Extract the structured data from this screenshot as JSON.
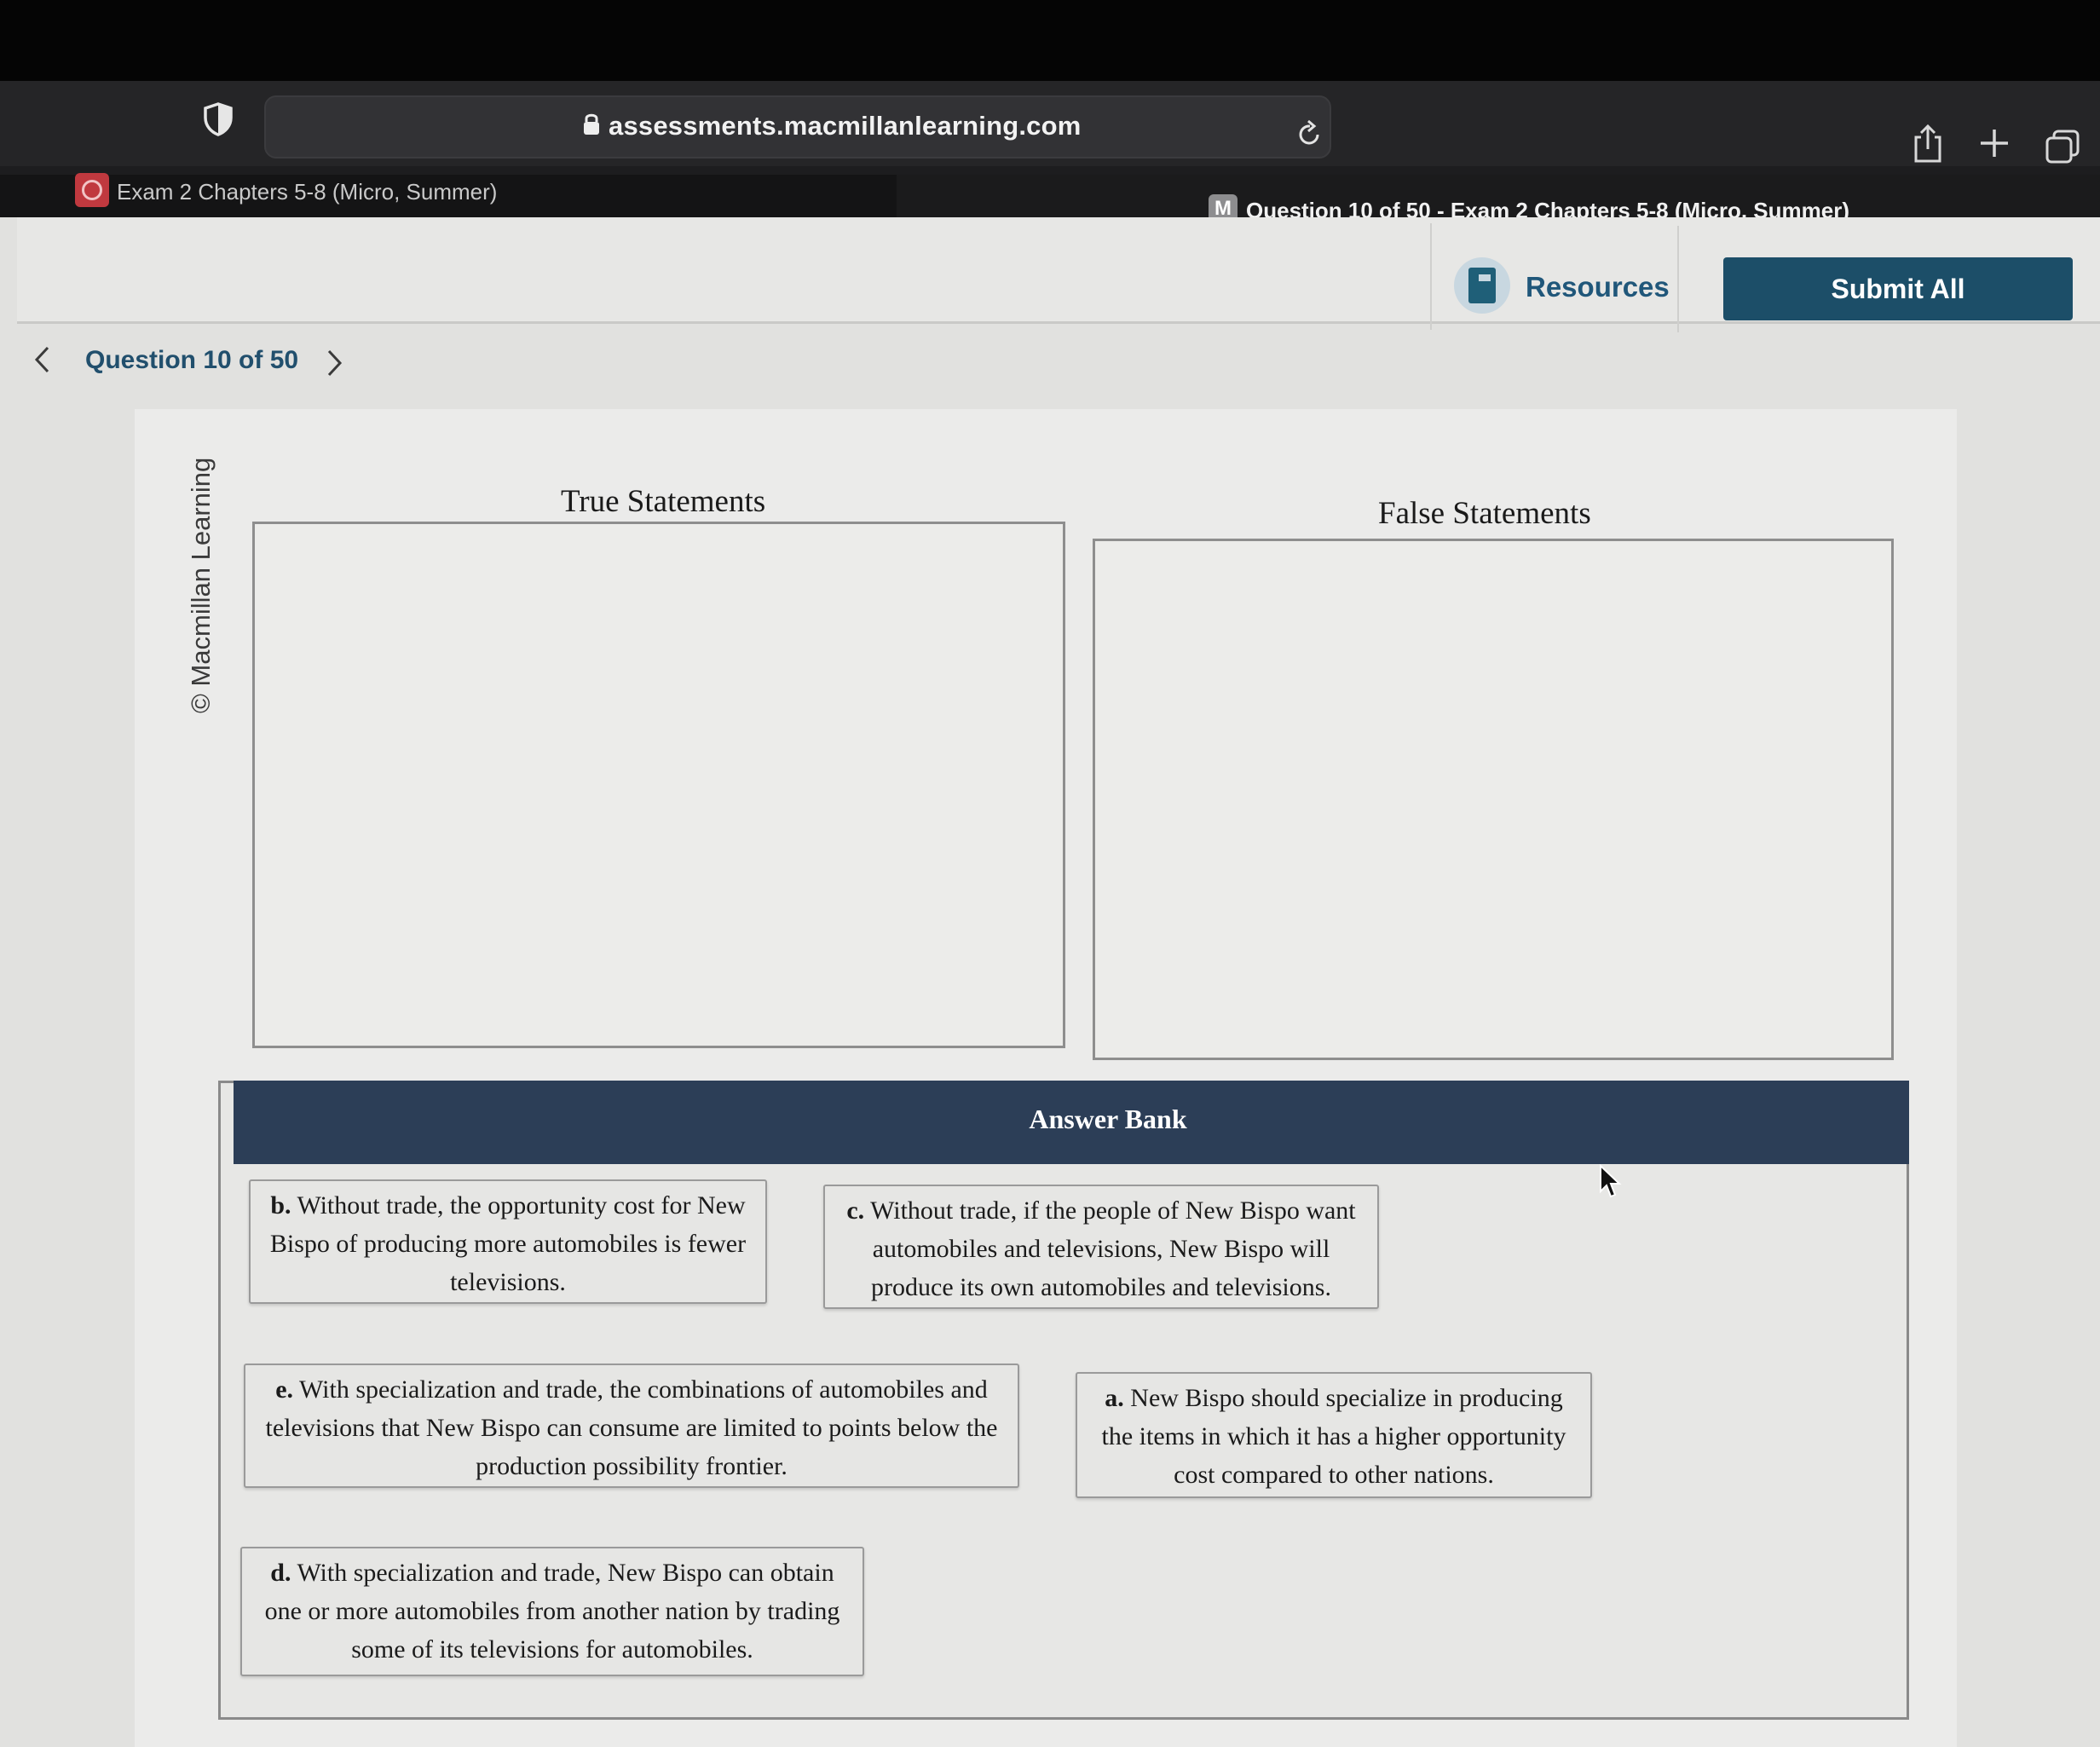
{
  "browser": {
    "url": "assessments.macmillanlearning.com",
    "tabs": [
      {
        "title": "Exam 2 Chapters 5-8 (Micro, Summer)"
      },
      {
        "favicon_letter": "M",
        "title": "Question 10 of 50 - Exam 2 Chapters 5-8 (Micro, Summer)"
      }
    ]
  },
  "header": {
    "resources_label": "Resources",
    "submit_label": "Submit All"
  },
  "nav": {
    "question_label": "Question 10 of 50"
  },
  "content": {
    "copyright": "© Macmillan Learning",
    "true_title": "True Statements",
    "false_title": "False Statements",
    "answer_bank_title": "Answer Bank",
    "statements": {
      "b": {
        "letter": "b.",
        "text": "Without trade, the opportunity cost for New Bispo of producing more automobiles is fewer televisions."
      },
      "c": {
        "letter": "c.",
        "text": "Without trade, if the people of New Bispo want automobiles and televisions, New Bispo will produce its own automobiles and televisions."
      },
      "e": {
        "letter": "e.",
        "text": "With specialization and trade, the combinations of automobiles and televisions that New Bispo can consume are limited to points below the production possibility frontier."
      },
      "a": {
        "letter": "a.",
        "text": "New Bispo should specialize in producing the items in which it has a higher opportunity cost compared to other nations."
      },
      "d": {
        "letter": "d.",
        "text": "With specialization and trade, New Bispo can obtain one or more automobiles from another nation by trading some of its televisions for automobiles."
      }
    }
  },
  "colors": {
    "accent": "#1c4e68",
    "answer_bank_header": "#2c3e57",
    "nav_text": "#214f6d"
  }
}
